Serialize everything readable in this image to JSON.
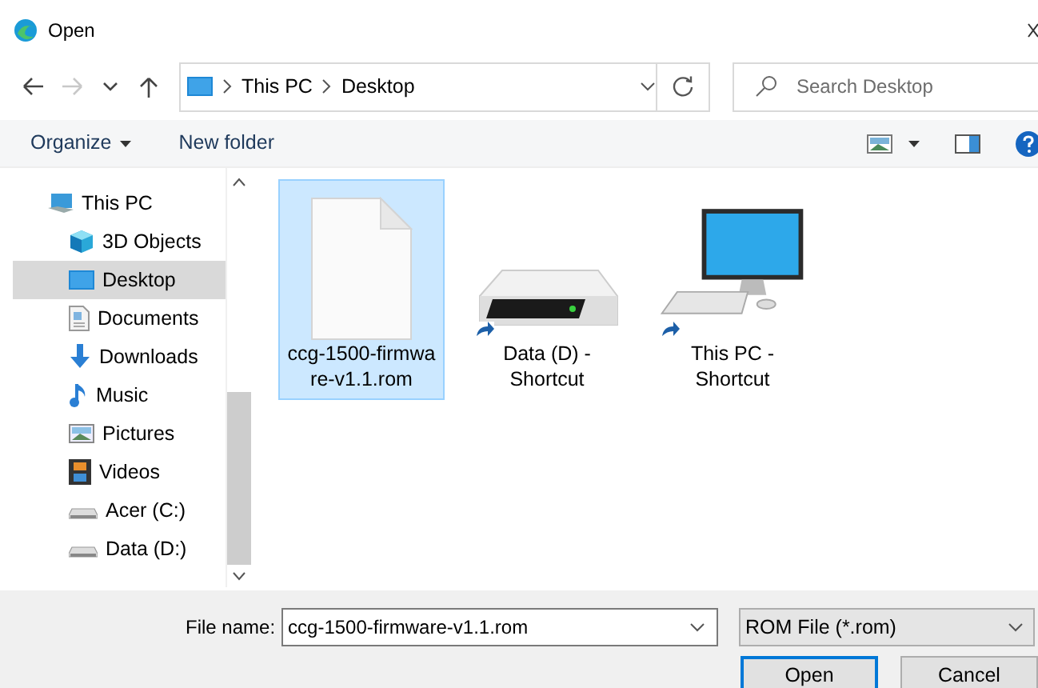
{
  "window": {
    "title": "Open"
  },
  "nav": [
    {
      "kind": "back",
      "disabled": false
    },
    {
      "kind": "forward",
      "disabled": true
    },
    {
      "kind": "recent",
      "disabled": false
    },
    {
      "kind": "up",
      "disabled": false
    }
  ],
  "address": {
    "crumbs": [
      "This PC",
      "Desktop"
    ]
  },
  "search": {
    "placeholder": "Search Desktop"
  },
  "toolbar": [
    {
      "label": "Organize",
      "dropdown": true
    },
    {
      "label": "New folder",
      "dropdown": false
    }
  ],
  "sidebar": {
    "items": [
      {
        "label": "This PC",
        "kind": "pc",
        "selected": false,
        "children": [
          {
            "label": "3D Objects",
            "kind": "cube",
            "selected": false
          },
          {
            "label": "Desktop",
            "kind": "desktop",
            "selected": true
          },
          {
            "label": "Documents",
            "kind": "document",
            "selected": false
          },
          {
            "label": "Downloads",
            "kind": "download",
            "selected": false
          },
          {
            "label": "Music",
            "kind": "music",
            "selected": false
          },
          {
            "label": "Pictures",
            "kind": "pictures",
            "selected": false
          },
          {
            "label": "Videos",
            "kind": "videos",
            "selected": false
          },
          {
            "label": "Acer (C:)",
            "kind": "drive",
            "selected": false
          },
          {
            "label": "Data (D:)",
            "kind": "drive",
            "selected": false
          }
        ]
      }
    ]
  },
  "files": [
    {
      "name": "ccg-1500-firmwa\nre-v1.1.rom",
      "kind": "file",
      "shortcut": false,
      "selected": true
    },
    {
      "name": "Data (D) -\nShortcut",
      "kind": "drive",
      "shortcut": true,
      "selected": false
    },
    {
      "name": "This PC - Shortcut",
      "kind": "computer",
      "shortcut": true,
      "selected": false
    }
  ],
  "file_name": {
    "label": "File name:",
    "value": "ccg-1500-firmware-v1.1.rom"
  },
  "file_type": {
    "value": "ROM File (*.rom)"
  },
  "buttons": [
    "Open",
    "Cancel"
  ]
}
